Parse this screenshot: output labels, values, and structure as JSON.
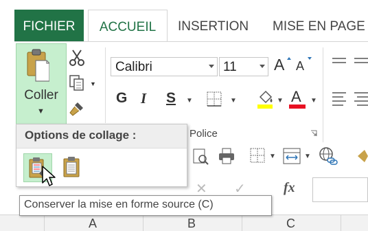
{
  "tabs": {
    "file": "FICHIER",
    "home": "ACCUEIL",
    "insert": "INSERTION",
    "page_layout": "MISE EN PAGE"
  },
  "clipboard": {
    "paste_label": "Coller"
  },
  "font": {
    "name": "Calibri",
    "size": "11",
    "grow_label": "A",
    "shrink_label": "A",
    "bold_label": "G",
    "italic_label": "I",
    "underline_label": "S",
    "group_label": "Police"
  },
  "paste_options": {
    "title": "Options de collage :"
  },
  "formula_bar": {
    "fx_label": "fx"
  },
  "tooltip": {
    "text": "Conserver la mise en forme source (C)"
  },
  "columns": [
    "A",
    "B",
    "C"
  ],
  "colors": {
    "file_tab": "#217346",
    "accent_green": "#217346",
    "paste_highlight": "#c6efce",
    "fill_yellow": "#ffff00",
    "font_red": "#e81123"
  },
  "icons": [
    "clipboard-icon",
    "scissors-icon",
    "copy-icon",
    "format-painter-icon",
    "border-icon",
    "fill-color-icon",
    "font-color-icon",
    "align-icon",
    "cursor-icon"
  ]
}
